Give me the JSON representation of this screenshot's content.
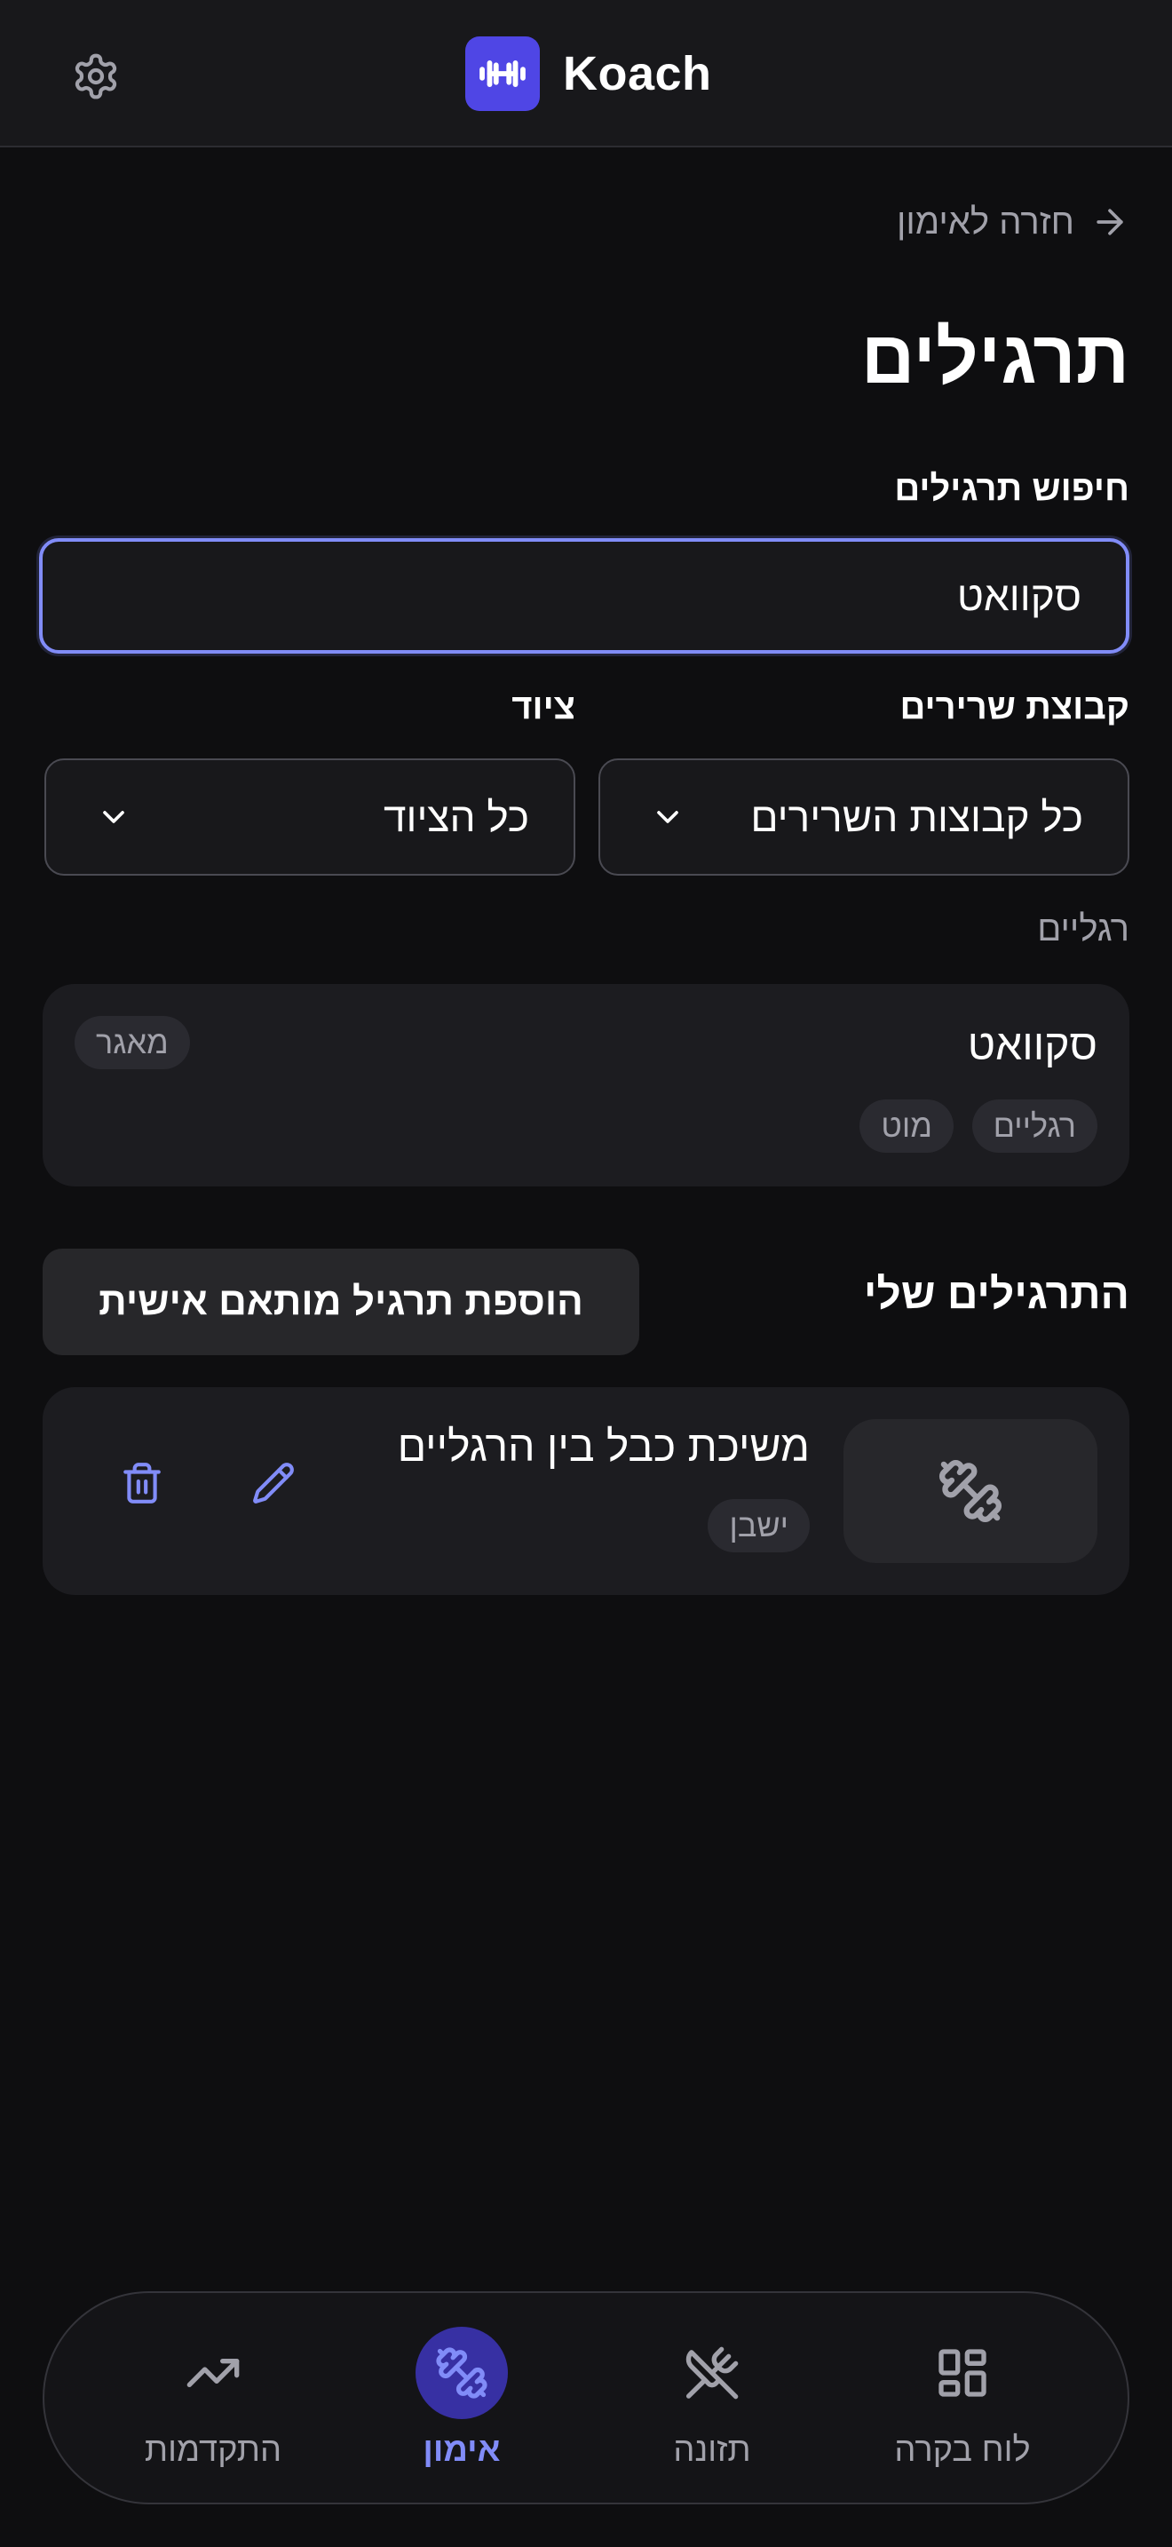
{
  "header": {
    "app_name": "Koach",
    "settings_icon": "gear-icon",
    "logo_icon": "dumbbell-icon",
    "accent_color": "#4f46e5"
  },
  "main": {
    "back_label": "חזרה לאימון",
    "page_title": "תרגילים",
    "search": {
      "label": "חיפוש תרגילים",
      "value": "סקוואט"
    },
    "filters": {
      "muscle_label": "קבוצת שרירים",
      "muscle_value": "כל קבוצות השרירים",
      "equipment_label": "ציוד",
      "equipment_value": "כל הציוד"
    },
    "library_group": {
      "label": "רגליים",
      "exercise": {
        "name": "סקוואט",
        "tags": [
          "רגליים",
          "מוט"
        ],
        "source_badge": "מאגר"
      }
    },
    "my_exercises": {
      "title": "התרגילים שלי",
      "add_button_label": "הוספת תרגיל מותאם אישית",
      "items": [
        {
          "name": "משיכת כבל בין הרגליים",
          "tag": "ישבן",
          "icon": "dumbbell-icon"
        }
      ]
    }
  },
  "bottom_nav": {
    "items": [
      {
        "label": "התקדמות",
        "icon": "trending-up-icon",
        "active": false
      },
      {
        "label": "אימון",
        "icon": "dumbbell-icon",
        "active": true
      },
      {
        "label": "תזונה",
        "icon": "utensils-crossed-icon",
        "active": false
      },
      {
        "label": "לוח בקרה",
        "icon": "dashboard-grid-icon",
        "active": false
      }
    ],
    "active_color": "#818cf8"
  }
}
